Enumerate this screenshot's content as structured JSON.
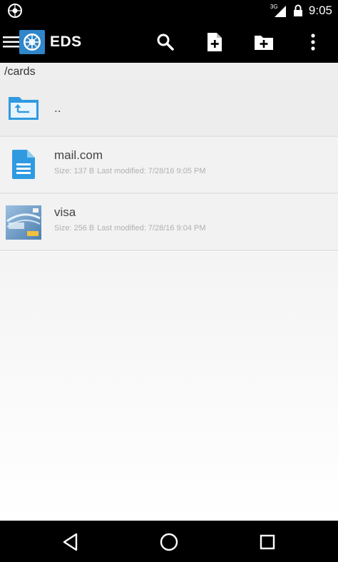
{
  "status_bar": {
    "network": "3G",
    "time": "9:05"
  },
  "app_bar": {
    "title": "EDS",
    "actions": [
      "search-icon",
      "new-file-icon",
      "new-folder-icon",
      "overflow-menu-icon"
    ]
  },
  "path": "/cards",
  "files": [
    {
      "name": "..",
      "type": "parent-folder"
    },
    {
      "name": "mail.com",
      "type": "document",
      "size": "Size: 137 B",
      "modified": "Last modified: 7/28/16 9:05 PM"
    },
    {
      "name": "visa",
      "type": "image",
      "size": "Size: 256 B",
      "modified": "Last modified: 7/28/16 9:04 PM"
    }
  ],
  "colors": {
    "accent": "#2f86c9",
    "bar_bg": "#000000"
  }
}
